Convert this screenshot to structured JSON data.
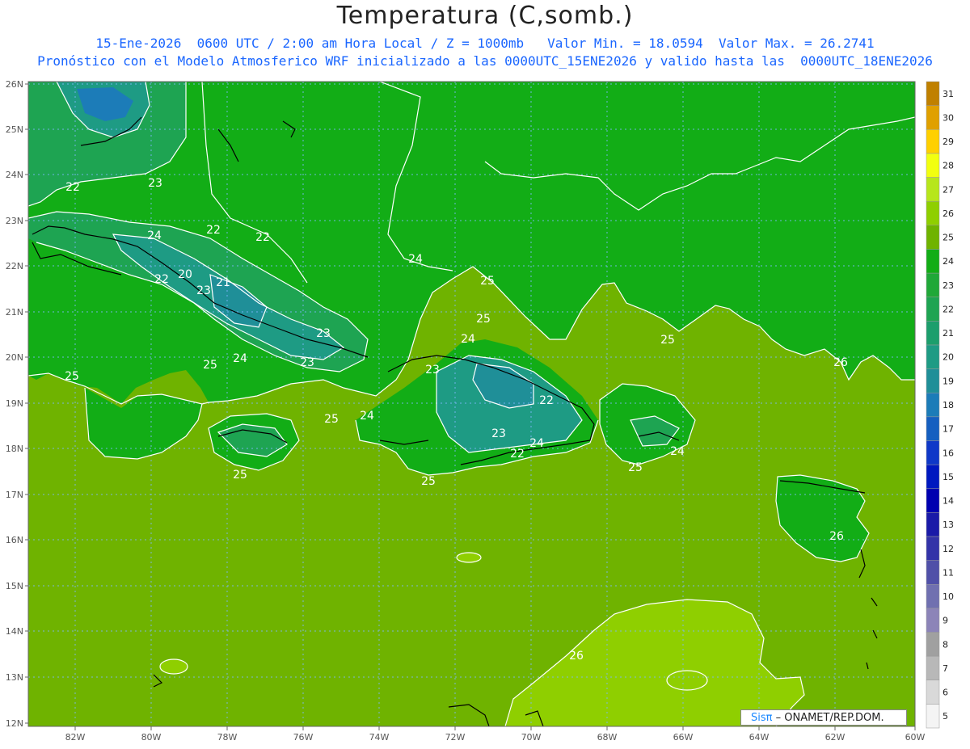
{
  "header": {
    "title": "Temperatura (C,somb.)",
    "line1": "15-Ene-2026  0600 UTC / 2:00 am Hora Local / Z = 1000mb   Valor Min. = 18.0594  Valor Max. = 26.2741",
    "line2": "Pronóstico con el Modelo Atmosferico WRF inicializado a las 0000UTC_15ENE2026 y valido hasta las  0000UTC_18ENE2026"
  },
  "map": {
    "lon_range": [
      -83.2,
      -60
    ],
    "lat_range": [
      12,
      26.3
    ],
    "lon_ticks": [
      "82W",
      "80W",
      "78W",
      "76W",
      "74W",
      "72W",
      "70W",
      "68W",
      "66W",
      "64W",
      "62W",
      "60W"
    ],
    "lat_ticks": [
      "12N",
      "13N",
      "14N",
      "15N",
      "16N",
      "17N",
      "18N",
      "19N",
      "20N",
      "21N",
      "22N",
      "23N",
      "24N",
      "25N",
      "26N"
    ],
    "contour_labels": [
      "22",
      "23",
      "24",
      "22",
      "23",
      "22",
      "20",
      "23",
      "21",
      "24",
      "25",
      "23",
      "22",
      "25",
      "25",
      "24",
      "25",
      "24",
      "23",
      "22",
      "23",
      "24",
      "22",
      "25",
      "25",
      "24",
      "24",
      "25",
      "25",
      "25",
      "26",
      "26",
      "26"
    ]
  },
  "colorbar": {
    "levels": [
      "5",
      "6",
      "7",
      "8",
      "9",
      "10",
      "11",
      "12",
      "13",
      "14",
      "15",
      "16",
      "17",
      "18",
      "19",
      "20",
      "21",
      "22",
      "23",
      "24",
      "25",
      "26",
      "27",
      "28",
      "29",
      "30",
      "31"
    ],
    "colors": [
      "#f4f4f4",
      "#d9d9d9",
      "#b8b8b8",
      "#a0a0a0",
      "#8c84b8",
      "#7070b0",
      "#5050a8",
      "#3333a8",
      "#1a1aa8",
      "#0000b0",
      "#0018c0",
      "#0f38c8",
      "#155fc0",
      "#1c7cb8",
      "#1f8f98",
      "#1e9b84",
      "#1c9e6c",
      "#1ea452",
      "#20a838",
      "#12ad16",
      "#6fb300",
      "#8fcf00",
      "#b7e61c",
      "#f2ff10",
      "#ffd000",
      "#e0a000",
      "#c08000"
    ]
  },
  "credit": {
    "brand": "Sisπ",
    "text": "– ONAMET/REP.DOM."
  },
  "colors": {
    "deep_green": "#12ad16",
    "sea_level_green": "#6fb300",
    "warm_lime": "#8fcf00",
    "cool_teal": "#1e9b84",
    "cold_blue": "#1c7cb8",
    "title_blue": "#1a66ff"
  }
}
